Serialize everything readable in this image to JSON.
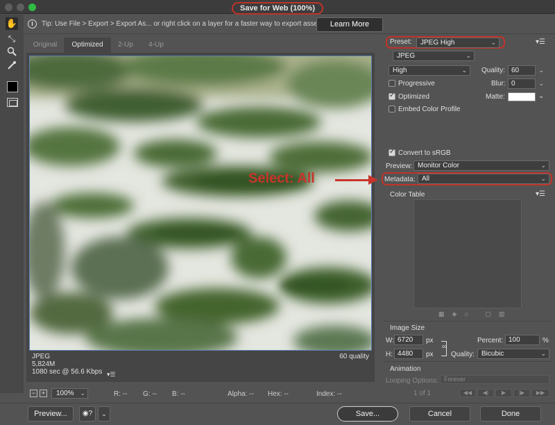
{
  "window": {
    "title": "Save for Web (100%)"
  },
  "toolbar": {
    "tools": [
      {
        "name": "hand-tool-icon",
        "glyph": "✋"
      },
      {
        "name": "slice-select-icon",
        "glyph": "⤡"
      },
      {
        "name": "zoom-tool-icon",
        "glyph": "🔍"
      },
      {
        "name": "eyedropper-icon",
        "glyph": "✎"
      }
    ]
  },
  "tip": {
    "text": "Tip: Use File > Export > Export As...  or right click on a layer for a faster way to export assets",
    "button": "Learn More"
  },
  "tabs": [
    "Original",
    "Optimized",
    "2-Up",
    "4-Up"
  ],
  "active_tab": "Optimized",
  "image_info": {
    "format": "JPEG",
    "size": "5,824M",
    "time": "1080 sec @ 56.6 Kbps",
    "quality": "60 quality"
  },
  "status": {
    "zoom": "100%",
    "r": "R: --",
    "g": "G: --",
    "b": "B: --",
    "alpha": "Alpha: --",
    "hex": "Hex: --",
    "index": "Index: --"
  },
  "settings": {
    "preset_label": "Preset:",
    "preset_value": "JPEG High",
    "format": "JPEG",
    "compression": "High",
    "quality_label": "Quality:",
    "quality_value": "60",
    "progressive": "Progressive",
    "blur_label": "Blur:",
    "blur_value": "0",
    "optimized": "Optimized",
    "matte_label": "Matte:",
    "embed_profile": "Embed Color Profile",
    "convert_srgb": "Convert to sRGB",
    "preview_label": "Preview:",
    "preview_value": "Monitor Color",
    "metadata_label": "Metadata:",
    "metadata_value": "All",
    "color_table": "Color Table",
    "image_size": "Image Size",
    "w_label": "W:",
    "w_value": "6720",
    "h_label": "H:",
    "h_value": "4480",
    "unit": "px",
    "percent_label": "Percent:",
    "percent_value": "100",
    "percent_unit": "%",
    "quality2_label": "Quality:",
    "resample": "Bicubic",
    "animation": "Animation",
    "looping_label": "Looping Options:",
    "looping_value": "Forever",
    "frame_counter": "1 of 1"
  },
  "annotation": {
    "text": "Select: All",
    "color": "#c8352c"
  },
  "buttons": {
    "preview": "Preview...",
    "save": "Save...",
    "cancel": "Cancel",
    "done": "Done"
  }
}
